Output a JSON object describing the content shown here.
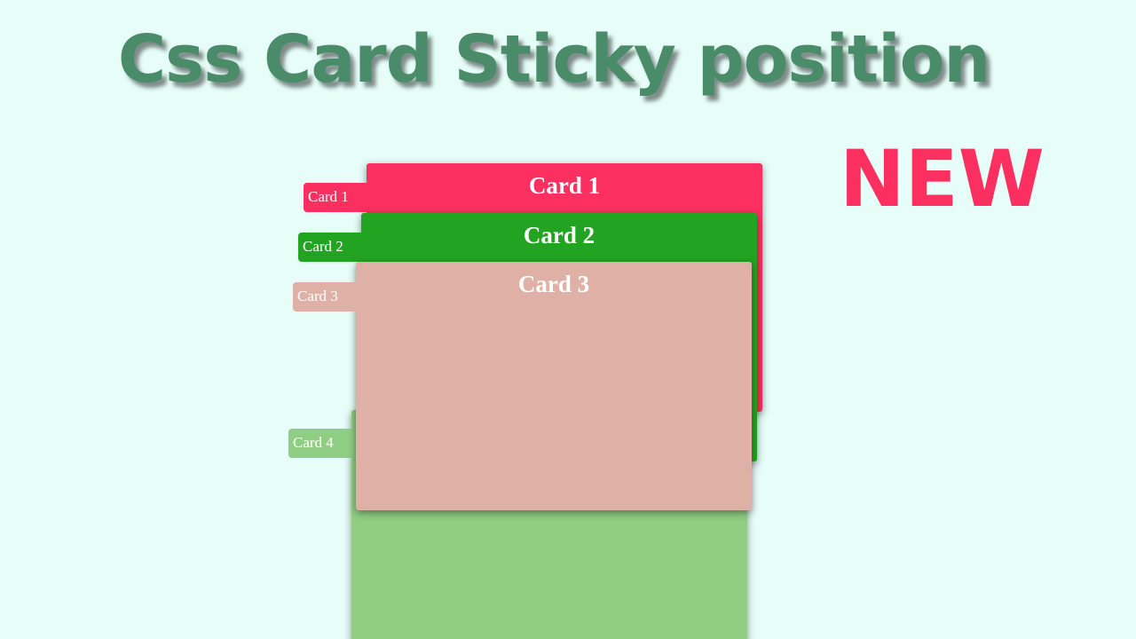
{
  "title": {
    "text": "Css Card Sticky position",
    "color": "#4a8b6a"
  },
  "badge": {
    "text": "NEW",
    "color": "#fb3060"
  },
  "background_color": "#e6fdf8",
  "cards": [
    {
      "title": "Card 1",
      "tab_label": "Card 1",
      "color": "#fb3060"
    },
    {
      "title": "Card 2",
      "tab_label": "Card 2",
      "color": "#23a322"
    },
    {
      "title": "Card 3",
      "tab_label": "Card 3",
      "color": "#dfb0a6"
    },
    {
      "title": "",
      "tab_label": "Card 4",
      "color": "#8fce83"
    }
  ]
}
